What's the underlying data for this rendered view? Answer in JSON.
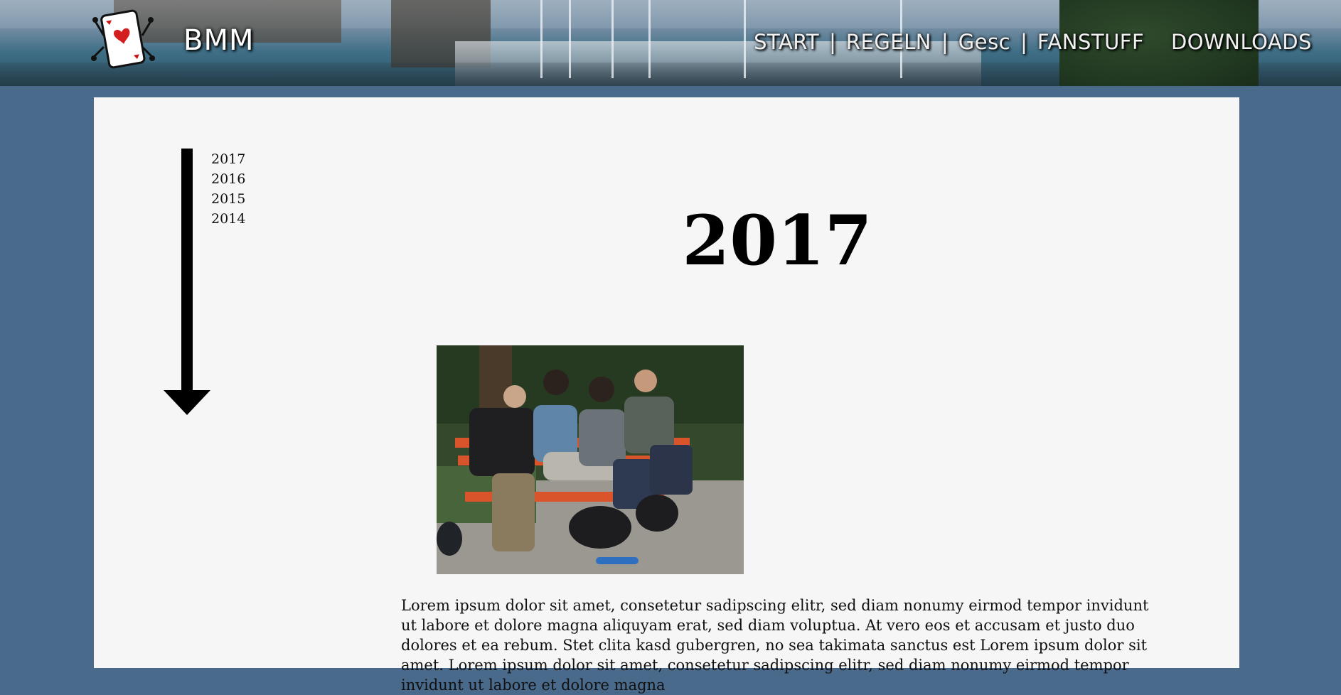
{
  "site": {
    "title": "BMM"
  },
  "nav": {
    "items": [
      {
        "label": "START"
      },
      {
        "label": "REGELN"
      },
      {
        "label": "Gesc"
      },
      {
        "label": "FANSTUFF"
      },
      {
        "label": "DOWNLOADS"
      }
    ],
    "separator": "|"
  },
  "timeline": {
    "years": [
      "2017",
      "2016",
      "2015",
      "2014"
    ]
  },
  "main": {
    "heading": "2017",
    "paragraph": "Lorem ipsum dolor sit amet, consetetur sadipscing elitr, sed diam nonumy eirmod tempor invidunt ut labore et dolore magna aliquyam erat, sed diam voluptua. At vero eos et accusam et justo duo dolores et ea rebum. Stet clita kasd gubergren, no sea takimata sanctus est Lorem ipsum dolor sit amet. Lorem ipsum dolor sit amet, consetetur sadipscing elitr, sed diam nonumy eirmod tempor invidunt ut labore et dolore magna"
  },
  "colors": {
    "page_background": "#4a6a8c",
    "panel_background": "#f6f6f6",
    "nav_text": "#f1f1f1"
  }
}
